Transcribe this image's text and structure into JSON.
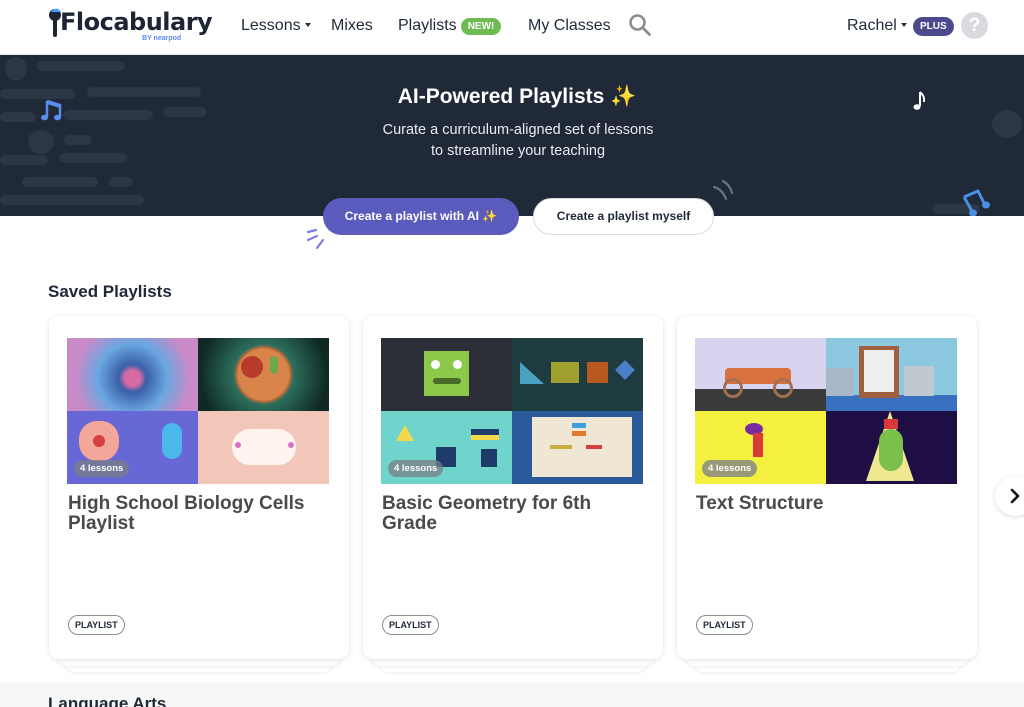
{
  "header": {
    "logo_text": "Flocabulary",
    "logo_sub": "BY nearpod",
    "nav": [
      {
        "label": "Lessons",
        "dropdown": true
      },
      {
        "label": "Mixes"
      },
      {
        "label": "Playlists",
        "badge": "NEW!"
      },
      {
        "label": "My Classes"
      }
    ],
    "search_icon": "search-icon",
    "user_name": "Rachel",
    "plan_badge": "PLUS",
    "help_icon": "?"
  },
  "banner": {
    "title": "AI-Powered Playlists ✨",
    "subtitle_line1": "Curate a curriculum-aligned set of lessons",
    "subtitle_line2": "to streamline your teaching",
    "primary_button": "Create a playlist with AI ✨",
    "secondary_button": "Create a playlist myself"
  },
  "colors": {
    "banner_bg": "#1f2937",
    "primary": "#5b5bbd",
    "new_badge": "#6dbb52",
    "plus_badge": "#4a4a8c"
  },
  "saved_playlists": {
    "title": "Saved Playlists",
    "cards": [
      {
        "title": "High School Biology Cells Playlist",
        "lessons": "4 lessons",
        "tag": "PLAYLIST"
      },
      {
        "title": "Basic Geometry for 6th Grade",
        "lessons": "4 lessons",
        "tag": "PLAYLIST"
      },
      {
        "title": "Text Structure",
        "lessons": "4 lessons",
        "tag": "PLAYLIST"
      }
    ]
  },
  "next_section": {
    "title": "Language Arts"
  }
}
